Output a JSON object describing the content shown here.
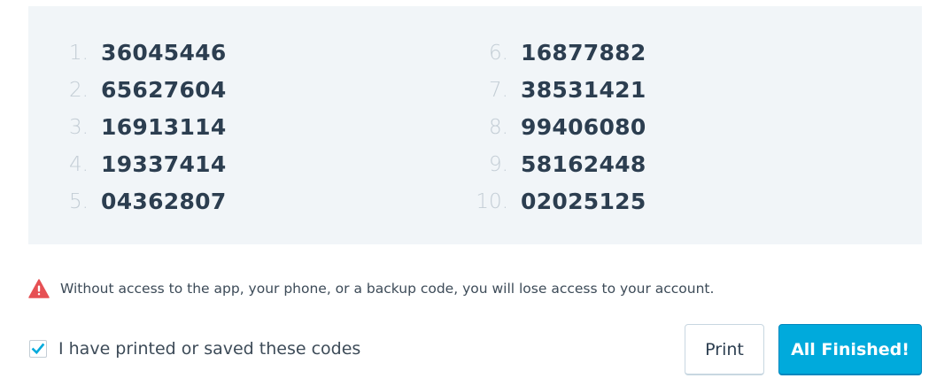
{
  "backup_codes": {
    "left": [
      {
        "index": "1.",
        "code": "36045446"
      },
      {
        "index": "2.",
        "code": "65627604"
      },
      {
        "index": "3.",
        "code": "16913114"
      },
      {
        "index": "4.",
        "code": "19337414"
      },
      {
        "index": "5.",
        "code": "04362807"
      }
    ],
    "right": [
      {
        "index": "6.",
        "code": "16877882"
      },
      {
        "index": "7.",
        "code": "38531421"
      },
      {
        "index": "8.",
        "code": "99406080"
      },
      {
        "index": "9.",
        "code": "58162448"
      },
      {
        "index": "10.",
        "code": "02025125"
      }
    ]
  },
  "warning": {
    "icon": "warning-triangle-icon",
    "text": "Without access to the app, your phone, or a backup code, you will lose access to your account.",
    "color": "#e65054"
  },
  "confirm": {
    "label": "I have printed or saved these codes",
    "checked": true,
    "check_color": "#00aadc"
  },
  "buttons": {
    "print_label": "Print",
    "finish_label": "All Finished!",
    "primary_color": "#00aadc"
  }
}
